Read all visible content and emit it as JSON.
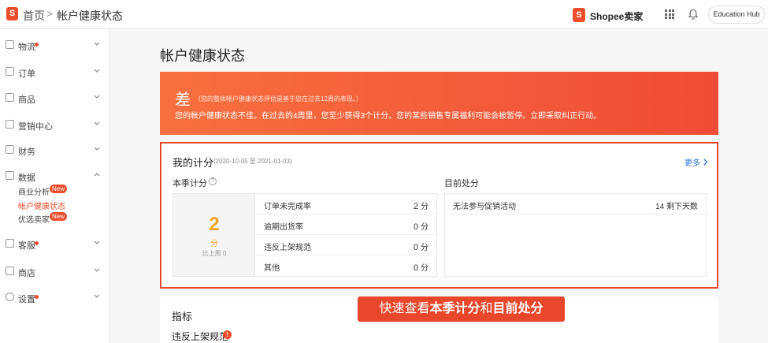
{
  "topbar": {
    "logo_letter": "S",
    "breadcrumb_home": "首页",
    "breadcrumb_sep": ">",
    "breadcrumb_page": "帐户健康状态",
    "brand_letter": "S",
    "brand_name": "Shopee卖家",
    "education_hub": "Education Hub"
  },
  "sidebar": {
    "logistics": "物流",
    "orders": "订单",
    "products": "商品",
    "marketing": "营销中心",
    "finance": "财务",
    "data": "数据",
    "data_sub": {
      "business_insights": "商业分析",
      "account_health": "帐户健康状态",
      "preferred_seller": "优选卖家",
      "new_badge": "New"
    },
    "customer_service": "客服",
    "shop": "商店",
    "settings": "设置"
  },
  "main": {
    "title": "帐户健康状态",
    "banner": {
      "grade": "差",
      "grade_note": "（您的整体帐户健康状态评估是基于您在过去12周的表现。）",
      "message": "您的帐户健康状态不佳。在过去的4周里，您至少获得3个计分。您的某些销售专属福利可能会被暂停。立即采取纠正行动。"
    },
    "points": {
      "title": "我的计分",
      "date_range": "(2020-10-05 至 2021-01-03)",
      "more": "更多",
      "quarter_label": "本季计分",
      "help": "?",
      "total": "2",
      "total_unit": "分",
      "last_week": "比上周 0",
      "rows": [
        {
          "label": "订单未完成率",
          "value": "2",
          "unit": "分"
        },
        {
          "label": "逾期出货率",
          "value": "0",
          "unit": "分"
        },
        {
          "label": "违反上架规范",
          "value": "0",
          "unit": "分"
        },
        {
          "label": "其他",
          "value": "0",
          "unit": "分"
        }
      ],
      "penalty_label": "目前处分",
      "penalty": {
        "name": "无法参与促销活动",
        "days": "14 剩下天数"
      }
    },
    "indicators": {
      "title": "指标",
      "item": "违反上架规范",
      "warn": "!"
    },
    "callout": {
      "prefix": "快速查看",
      "bold1": "本季计分",
      "mid": "和",
      "bold2": "目前处分"
    }
  },
  "colors": {
    "brand": "#ee4d2d",
    "score": "#f6a623",
    "link": "#2673dd"
  }
}
